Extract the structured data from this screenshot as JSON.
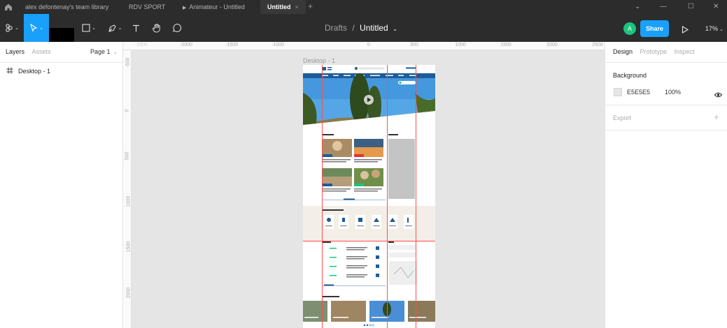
{
  "tabs": {
    "items": [
      {
        "label": "alex defontenay's team library"
      },
      {
        "label": "RDV SPORT"
      },
      {
        "label": "Animateur - Untitled"
      },
      {
        "label": "Untitled",
        "close": "×"
      }
    ],
    "add": "+"
  },
  "window_controls": {
    "collapse": "⌄",
    "minimize": "—",
    "maximize": "☐",
    "close": "✕"
  },
  "toolbar": {
    "project": "Drafts",
    "separator": "/",
    "file_name": "Untitled",
    "user_initial": "A",
    "share_label": "Share",
    "zoom": "17%"
  },
  "left_panel": {
    "tab_layers": "Layers",
    "tab_assets": "Assets",
    "page": "Page 1",
    "layers": [
      {
        "name": "Desktop - 1"
      }
    ]
  },
  "rulers": {
    "horizontal": [
      "-2500",
      "-2000",
      "-1500",
      "-1000",
      "0",
      "500",
      "1000",
      "1500",
      "2000",
      "2500"
    ],
    "vertical": [
      "-500",
      "0",
      "500",
      "1000",
      "1500",
      "2000"
    ]
  },
  "canvas": {
    "frame_label": "Desktop - 1"
  },
  "right_panel": {
    "tab_design": "Design",
    "tab_prototype": "Prototype",
    "tab_inspect": "Inspect",
    "background_title": "Background",
    "background_hex": "E5E5E5",
    "background_opacity": "100%",
    "export_title": "Export",
    "export_add": "+"
  },
  "colors": {
    "chrome": "#2c2c2c",
    "accent": "#18a0fb",
    "avatar": "#1bc47d",
    "canvas_bg": "#e5e5e5",
    "guide": "#ff4d4d",
    "site_nav": "#1d5c98"
  }
}
